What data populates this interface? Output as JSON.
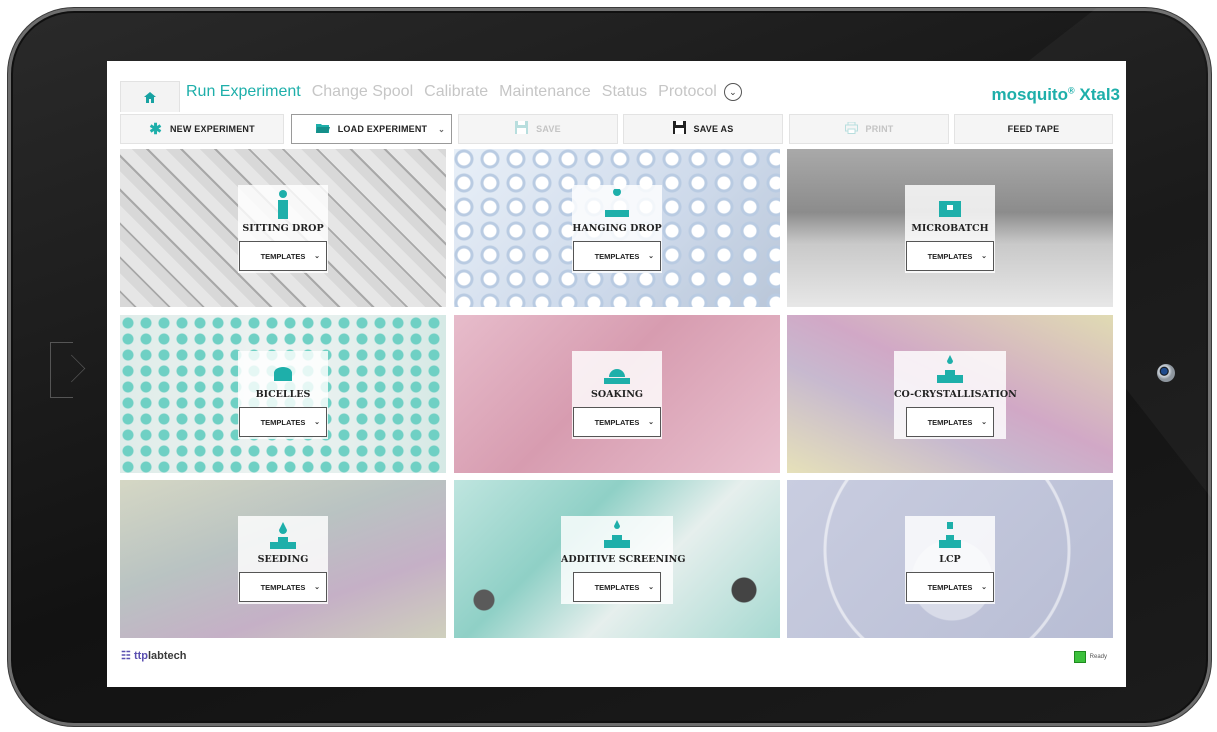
{
  "nav": {
    "home_icon": "home-icon",
    "items": [
      "Run Experiment",
      "Change Spool",
      "Calibrate",
      "Maintenance",
      "Status",
      "Protocol"
    ],
    "more_icon": "chevron-down-circle-icon"
  },
  "brand": {
    "name": "mosquito",
    "reg": "®",
    "model": "Xtal3",
    "color": "#1eafaa"
  },
  "toolbar": {
    "new_experiment": "NEW EXPERIMENT",
    "load_experiment": "LOAD EXPERIMENT",
    "save": "SAVE",
    "save_as": "SAVE AS",
    "print": "PRINT",
    "feed_tape": "FEED TAPE"
  },
  "tiles": [
    {
      "title": "SITTING DROP",
      "templates": "TEMPLATES"
    },
    {
      "title": "HANGING DROP",
      "templates": "TEMPLATES"
    },
    {
      "title": "MICROBATCH",
      "templates": "TEMPLATES"
    },
    {
      "title": "BICELLES",
      "templates": "TEMPLATES"
    },
    {
      "title": "SOAKING",
      "templates": "TEMPLATES"
    },
    {
      "title": "CO-CRYSTALLISATION",
      "templates": "TEMPLATES"
    },
    {
      "title": "SEEDING",
      "templates": "TEMPLATES"
    },
    {
      "title": "ADDITIVE SCREENING",
      "templates": "TEMPLATES"
    },
    {
      "title": "LCP",
      "templates": "TEMPLATES"
    }
  ],
  "footer": {
    "logo_ttp": "ttp",
    "logo_rest": "labtech",
    "status": "Ready"
  }
}
